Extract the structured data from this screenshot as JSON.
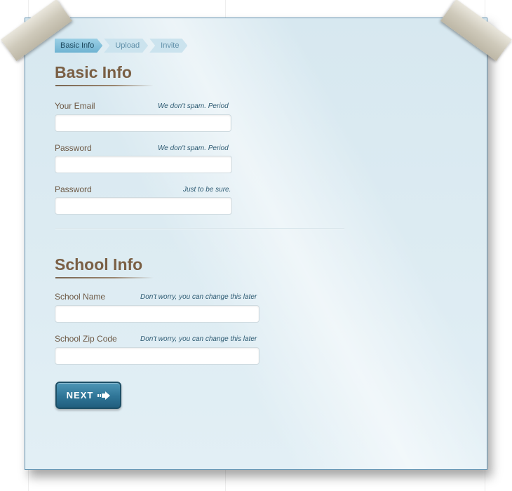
{
  "steps": [
    {
      "label": "Basic Info",
      "active": true
    },
    {
      "label": "Upload",
      "active": false
    },
    {
      "label": "Invite",
      "active": false
    }
  ],
  "basic_info": {
    "title": "Basic Info",
    "fields": [
      {
        "label": "Your Email",
        "hint": "We don't spam. Period",
        "value": ""
      },
      {
        "label": "Password",
        "hint": "We don't spam. Period",
        "value": ""
      },
      {
        "label": "Password",
        "hint": "Just to be sure.",
        "value": ""
      }
    ]
  },
  "school_info": {
    "title": "School Info",
    "fields": [
      {
        "label": "School Name",
        "hint": "Don't worry, you can change this later",
        "value": ""
      },
      {
        "label": "School Zip Code",
        "hint": "Don't worry, you can change this later",
        "value": ""
      }
    ]
  },
  "next_button": {
    "label": "NEXT",
    "icon": "arrow-right-icon"
  },
  "colors": {
    "accent": "#2f7597",
    "label": "#6d5945",
    "hint": "#2d5a72",
    "sheet": "#dcebf2"
  }
}
